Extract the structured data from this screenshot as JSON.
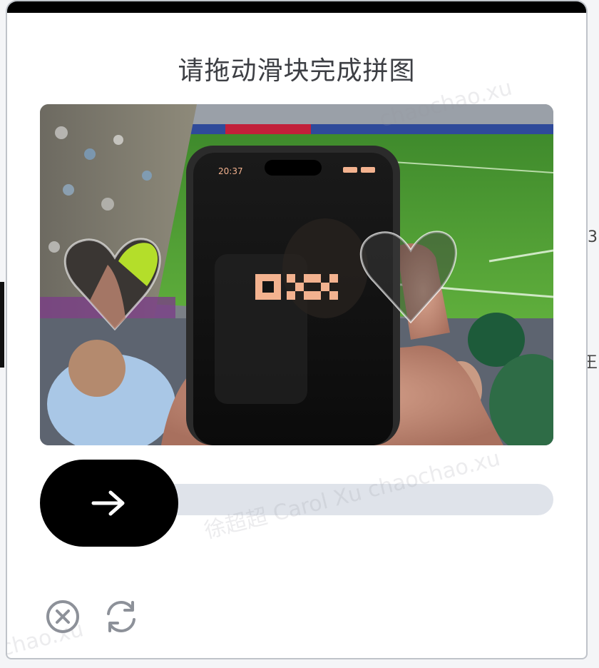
{
  "dialog": {
    "title": "请拖动滑块完成拼图"
  },
  "puzzle": {
    "phone_logo": "OKX",
    "phone_time": "20:37",
    "image": "photo of a phone showing the OKX logo held up at a football stadium",
    "target_slot_shape": "heart",
    "piece_shape": "heart"
  },
  "slider": {
    "handle_icon": "arrow-right-icon",
    "position": 0
  },
  "footer": {
    "close_icon": "close-circle-icon",
    "refresh_icon": "refresh-icon"
  },
  "watermark": {
    "text_1": "chaochao.xu",
    "text_2": "徐超超 Carol Xu chaochao.xu",
    "text_3": "chao.xu"
  },
  "colors": {
    "dialog_header": "#000000",
    "track": "#dfe3ea",
    "handle": "#000000",
    "logo": "#f3b28f"
  }
}
